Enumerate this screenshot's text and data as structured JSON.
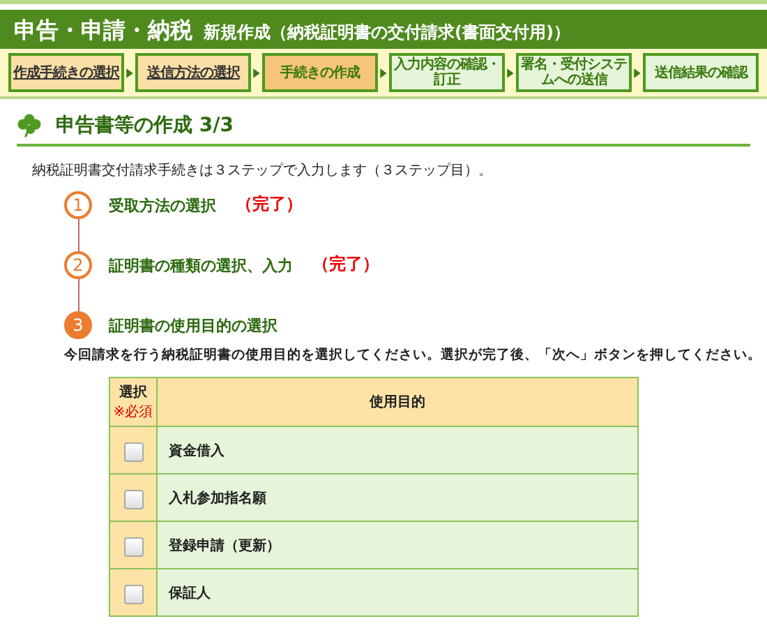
{
  "header": {
    "title": "申告・申請・納税",
    "subtitle": "新規作成（納税証明書の交付請求(書面交付用)）"
  },
  "steps": [
    {
      "label": "作成手続きの選択",
      "completed": true,
      "selected": false
    },
    {
      "label": "送信方法の選択",
      "completed": true,
      "selected": false
    },
    {
      "label": "手続きの作成",
      "completed": false,
      "selected": true
    },
    {
      "label": "入力内容の確認・訂正",
      "completed": false,
      "selected": false
    },
    {
      "label": "署名・受付システムへの送信",
      "completed": false,
      "selected": false
    },
    {
      "label": "送信結果の確認",
      "completed": false,
      "selected": false
    }
  ],
  "section": {
    "title": "申告書等の作成 3/3",
    "intro": "納税証明書交付請求手続きは３ステップで入力します（３ステップ目）。"
  },
  "substeps": [
    {
      "number": "1",
      "label": "受取方法の選択",
      "status": "（完了）",
      "selected": false
    },
    {
      "number": "2",
      "label": "証明書の種類の選択、入力",
      "status": "（完了）",
      "selected": false
    },
    {
      "number": "3",
      "label": "証明書の使用目的の選択",
      "selected": true,
      "description": "今回請求を行う納税証明書の使用目的を選択してください。選択が完了後、「次へ」ボタンを押してください。"
    }
  ],
  "table": {
    "columns": [
      {
        "label": "選択",
        "note": "※必須"
      },
      {
        "label": "使用目的"
      }
    ],
    "rows": [
      {
        "checked": false,
        "purpose": "資金借入"
      },
      {
        "checked": false,
        "purpose": "入札参加指名願"
      },
      {
        "checked": false,
        "purpose": "登録申請（更新）"
      },
      {
        "checked": false,
        "purpose": "保証人"
      }
    ]
  }
}
